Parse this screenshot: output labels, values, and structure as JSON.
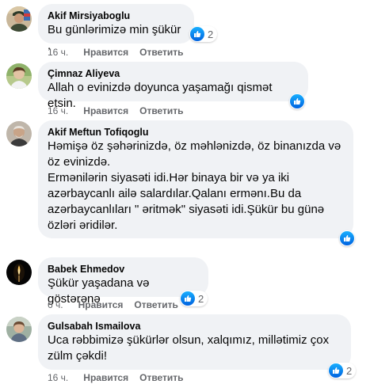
{
  "comments": [
    {
      "author": "Akif Mirsiyaboglu",
      "text": "Bu günlərimizə min şükür .",
      "time": "16 ч.",
      "like_label": "Нравится",
      "reply_label": "Ответить",
      "reaction_count": "2",
      "avatar": "military-portrait"
    },
    {
      "author": "Çimnaz Aliyeva",
      "text": "Allah o evinizdə doyunca yaşamağı qismət etsin.",
      "time": "16 ч.",
      "like_label": "Нравится",
      "reply_label": "Ответить",
      "avatar": "woman-portrait"
    },
    {
      "author": "Akif Meftun Tofiqoglu",
      "text": "Həmişə öz şəhərinizdə, öz məhlənizdə, öz binanızda və öz evinizdə.\nErmənilərin siyasəti idi.Hər binaya bir və ya iki azərbaycanlı ailə salardılar.Qalanı ermənı.Bu da azərbaycanlıları \" əritmək\" siyasəti idi.Şükür bu günə özləri əridilər.",
      "time": "",
      "avatar": "man-portrait"
    },
    {
      "author": "Babek Ehmedov",
      "text": "Şükür yaşadana və göstərənə",
      "time": "6 ч.",
      "like_label": "Нравится",
      "reply_label": "Ответить",
      "reaction_count": "2",
      "avatar": "candle"
    },
    {
      "author": "Gulsabah Ismailova",
      "text": "Uca rəbbimizə şükürlər olsun, xalqımız, millətimiz çox zülm çəkdi!",
      "time": "16 ч.",
      "like_label": "Нравится",
      "reply_label": "Ответить",
      "reaction_count": "2",
      "avatar": "woman-portrait"
    }
  ],
  "colors": {
    "bubble": "#f0f2f5",
    "meta": "#65676b",
    "like": "#0866ff"
  }
}
